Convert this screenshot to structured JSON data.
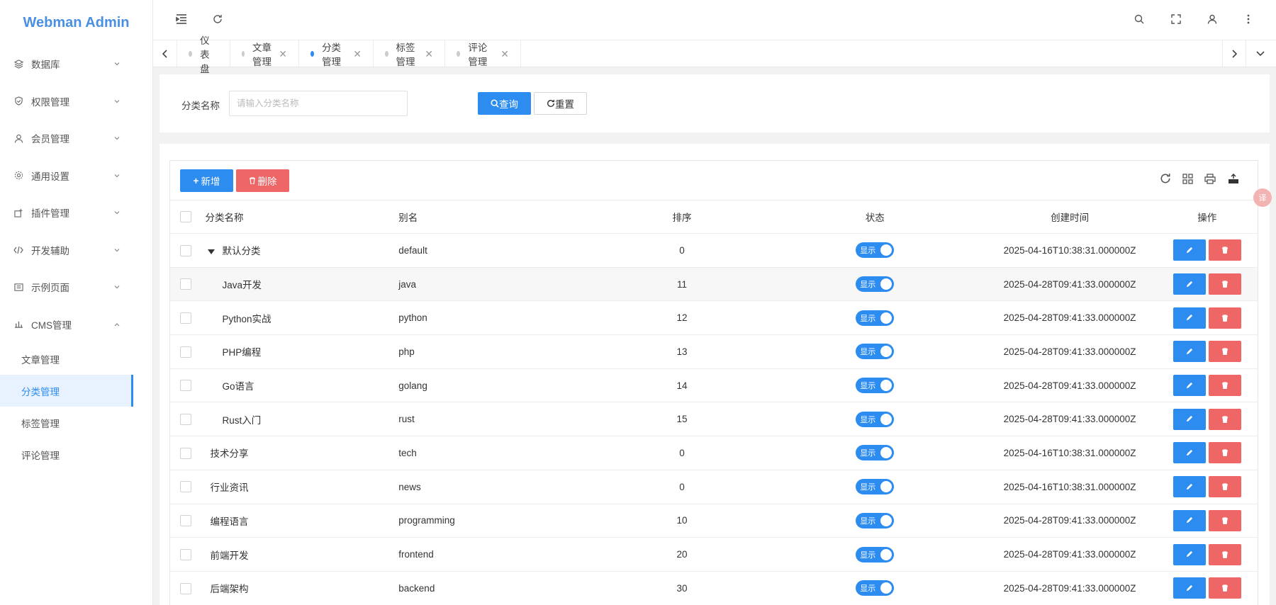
{
  "app": {
    "title": "Webman Admin"
  },
  "sidebar": {
    "items": [
      {
        "label": "数据库",
        "icon": "database-icon"
      },
      {
        "label": "权限管理",
        "icon": "shield-icon"
      },
      {
        "label": "会员管理",
        "icon": "user-icon"
      },
      {
        "label": "通用设置",
        "icon": "gear-icon"
      },
      {
        "label": "插件管理",
        "icon": "plugin-icon"
      },
      {
        "label": "开发辅助",
        "icon": "code-icon"
      },
      {
        "label": "示例页面",
        "icon": "book-icon"
      },
      {
        "label": "CMS管理",
        "icon": "cms-icon"
      }
    ],
    "sub_items": [
      {
        "label": "文章管理",
        "active": false
      },
      {
        "label": "分类管理",
        "active": true
      },
      {
        "label": "标签管理",
        "active": false
      },
      {
        "label": "评论管理",
        "active": false
      }
    ]
  },
  "tabs": [
    {
      "label": "仪表盘",
      "closable": false,
      "active": false
    },
    {
      "label": "文章管理",
      "closable": true,
      "active": false
    },
    {
      "label": "分类管理",
      "closable": true,
      "active": true
    },
    {
      "label": "标签管理",
      "closable": true,
      "active": false
    },
    {
      "label": "评论管理",
      "closable": true,
      "active": false
    }
  ],
  "search": {
    "label": "分类名称",
    "placeholder": "请输入分类名称",
    "query_label": "查询",
    "reset_label": "重置"
  },
  "toolbar": {
    "add_label": "新增",
    "delete_label": "删除"
  },
  "table": {
    "columns": [
      "分类名称",
      "别名",
      "排序",
      "状态",
      "创建时间",
      "操作"
    ],
    "status_label": "显示",
    "rows": [
      {
        "name": "默认分类",
        "alias": "default",
        "sort": "0",
        "created": "2025-04-16T10:38:31.000000Z",
        "level": 0,
        "expanded": true
      },
      {
        "name": "Java开发",
        "alias": "java",
        "sort": "11",
        "created": "2025-04-28T09:41:33.000000Z",
        "level": 1
      },
      {
        "name": "Python实战",
        "alias": "python",
        "sort": "12",
        "created": "2025-04-28T09:41:33.000000Z",
        "level": 1
      },
      {
        "name": "PHP编程",
        "alias": "php",
        "sort": "13",
        "created": "2025-04-28T09:41:33.000000Z",
        "level": 1
      },
      {
        "name": "Go语言",
        "alias": "golang",
        "sort": "14",
        "created": "2025-04-28T09:41:33.000000Z",
        "level": 1
      },
      {
        "name": "Rust入门",
        "alias": "rust",
        "sort": "15",
        "created": "2025-04-28T09:41:33.000000Z",
        "level": 1
      },
      {
        "name": "技术分享",
        "alias": "tech",
        "sort": "0",
        "created": "2025-04-16T10:38:31.000000Z",
        "level": 0
      },
      {
        "name": "行业资讯",
        "alias": "news",
        "sort": "0",
        "created": "2025-04-16T10:38:31.000000Z",
        "level": 0
      },
      {
        "name": "编程语言",
        "alias": "programming",
        "sort": "10",
        "created": "2025-04-28T09:41:33.000000Z",
        "level": 0
      },
      {
        "name": "前端开发",
        "alias": "frontend",
        "sort": "20",
        "created": "2025-04-28T09:41:33.000000Z",
        "level": 0
      },
      {
        "name": "后端架构",
        "alias": "backend",
        "sort": "30",
        "created": "2025-04-28T09:41:33.000000Z",
        "level": 0
      }
    ]
  },
  "colors": {
    "primary": "#2d8cf0",
    "danger": "#ee6666",
    "brand": "#4a90e2"
  }
}
